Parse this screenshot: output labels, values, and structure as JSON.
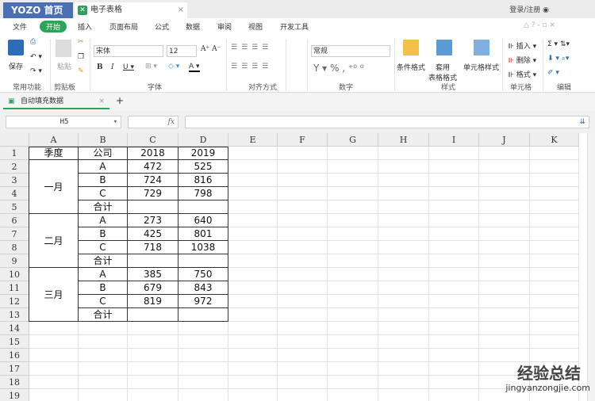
{
  "titlebar": {
    "home": "YOZO 首页",
    "doc_tab": "电子表格",
    "close": "×",
    "login": "登录/注册"
  },
  "menu": [
    "文件",
    "开始",
    "插入",
    "页面布局",
    "公式",
    "数据",
    "审阅",
    "视图",
    "开发工具"
  ],
  "ribbon": {
    "save": "保存",
    "paste": "粘贴",
    "font_name": "宋体",
    "font_size": "12",
    "number_format": "常规",
    "cond_format": "条件格式",
    "table_format": "套用\n表格格式",
    "cell_style": "单元格样式",
    "insert": "插入",
    "delete": "删除",
    "format": "格式",
    "groups": [
      "常用功能",
      "剪贴板",
      "字体",
      "对齐方式",
      "数字",
      "样式",
      "单元格",
      "编辑"
    ]
  },
  "sheet_tab": "自动填充数据",
  "formula_bar": {
    "name_box": "H5",
    "fx": "fx",
    "value": ""
  },
  "columns": [
    "A",
    "B",
    "C",
    "D",
    "E",
    "F",
    "G",
    "H",
    "I",
    "J",
    "K"
  ],
  "rows": [
    "1",
    "2",
    "3",
    "4",
    "5",
    "6",
    "7",
    "8",
    "9",
    "10",
    "11",
    "12",
    "13",
    "14",
    "15",
    "16",
    "17",
    "18",
    "19"
  ],
  "table": {
    "header": [
      "季度",
      "公司",
      "2018",
      "2019"
    ],
    "quarters": [
      "一月",
      "二月",
      "三月"
    ],
    "blocks": [
      [
        [
          "A",
          "472",
          "525"
        ],
        [
          "B",
          "724",
          "816"
        ],
        [
          "C",
          "729",
          "798"
        ],
        [
          "合计",
          "",
          ""
        ]
      ],
      [
        [
          "A",
          "273",
          "640"
        ],
        [
          "B",
          "425",
          "801"
        ],
        [
          "C",
          "718",
          "1038"
        ],
        [
          "合计",
          "",
          ""
        ]
      ],
      [
        [
          "A",
          "385",
          "750"
        ],
        [
          "B",
          "679",
          "843"
        ],
        [
          "C",
          "819",
          "972"
        ],
        [
          "合计",
          "",
          ""
        ]
      ]
    ]
  },
  "watermark": {
    "title": "经验总结",
    "url": "jingyanzongjie.com"
  }
}
